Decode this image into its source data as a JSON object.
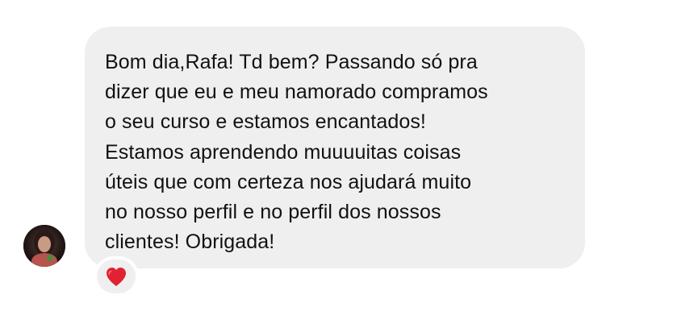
{
  "message": {
    "text": "Bom dia,Rafa! Td bem? Passando só pra\ndizer que eu e meu namorado compramos\no seu curso e estamos encantados!\nEstamos aprendendo muuuuitas coisas\núteis que com certeza nos ajudará muito\nno nosso perfil e no perfil dos nossos\nclientes! Obrigada!",
    "reaction": "heart-icon"
  },
  "colors": {
    "bubble_background": "#efefef",
    "text": "#111111",
    "reaction_heart": "#e02232",
    "page_background": "#ffffff"
  }
}
